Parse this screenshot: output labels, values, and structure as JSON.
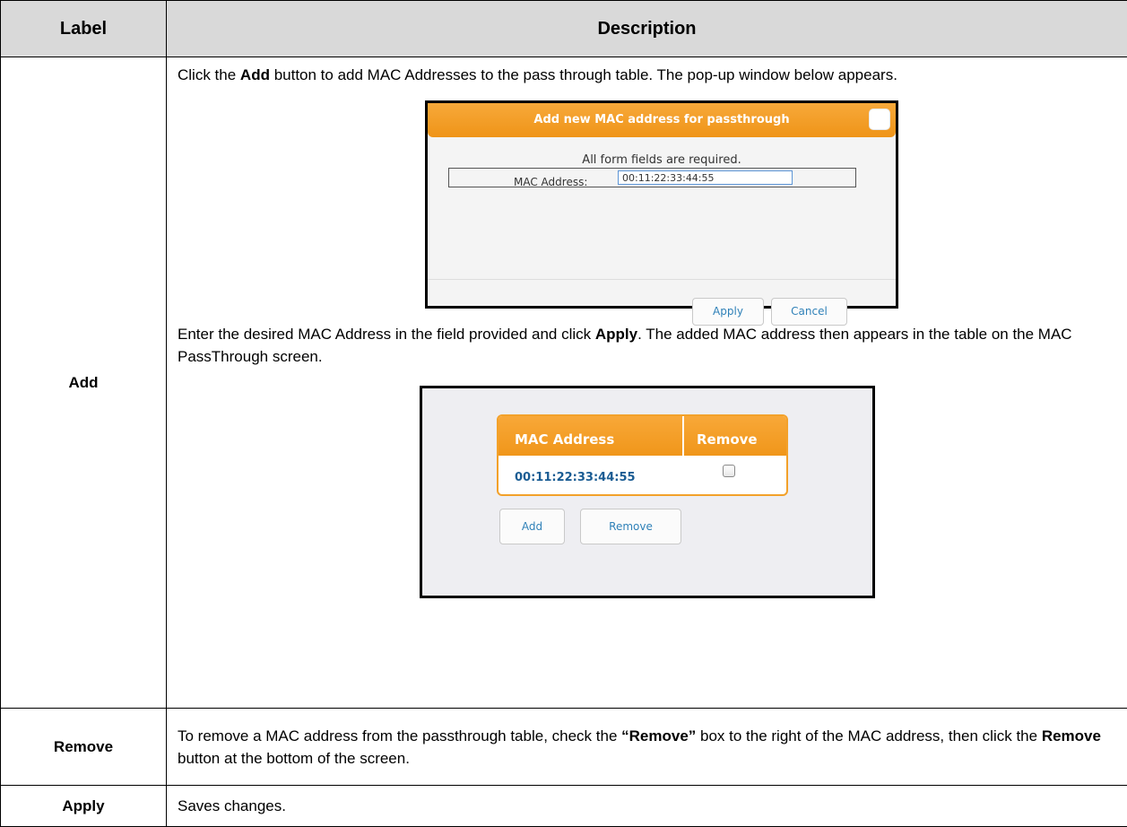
{
  "table": {
    "headers": {
      "label": "Label",
      "description": "Description"
    },
    "rows": [
      {
        "label": "Add",
        "intro": {
          "pre": "Click the ",
          "bold": "Add",
          "post": " button to add MAC Addresses to the pass through table. The pop-up window below appears."
        },
        "popup": {
          "title": "Add new MAC address for passthrough",
          "note": "All form fields are required.",
          "field_label": "MAC Address:",
          "field_value": "00:11:22:33:44:55",
          "apply_label": "Apply",
          "cancel_label": "Cancel"
        },
        "after": {
          "pre": "Enter the desired MAC Address in the field provided and click ",
          "bold": "Apply",
          "post": ". The added MAC address then appears in the table on the MAC PassThrough screen."
        },
        "panel": {
          "col_mac": "MAC Address",
          "col_remove": "Remove",
          "mac_value": "00:11:22:33:44:55",
          "remove_checked": false,
          "add_label": "Add",
          "remove_label": "Remove"
        }
      },
      {
        "label": "Remove",
        "desc": {
          "pre": "To remove a MAC address from the passthrough table, check the ",
          "bold1": "“Remove”",
          "mid": " box to the right of the MAC address, then click the ",
          "bold2": "Remove",
          "post": " button at the bottom of the screen."
        }
      },
      {
        "label": "Apply",
        "desc": "Saves changes."
      }
    ]
  },
  "colors": {
    "header_bg": "#d9d9d9",
    "accent_orange": "#f39c22",
    "link_blue": "#2f81b8",
    "mac_blue": "#1a5c93"
  }
}
